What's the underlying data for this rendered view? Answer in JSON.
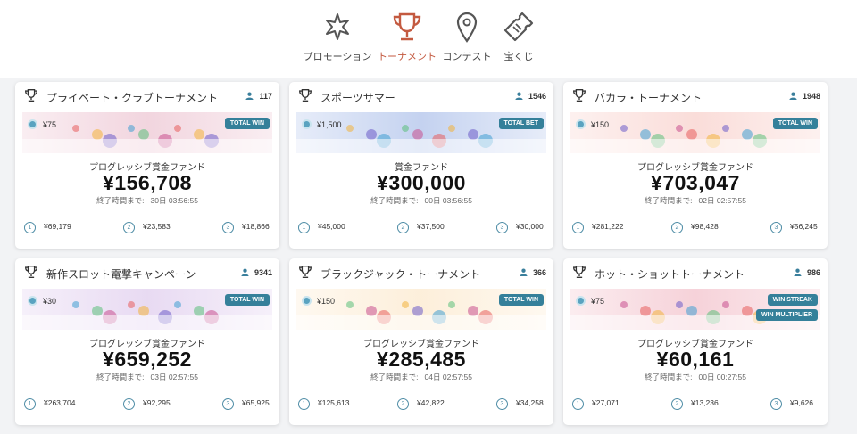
{
  "nav": [
    {
      "label": "プロモーション",
      "icon": "sparkle-icon",
      "active": false
    },
    {
      "label": "トーナメント",
      "icon": "trophy-icon",
      "active": true
    },
    {
      "label": "コンテスト",
      "icon": "location-pin-icon",
      "active": false
    },
    {
      "label": "宝くじ",
      "icon": "ticket-icon",
      "active": false
    }
  ],
  "colors": {
    "accent": "#c45a40",
    "badge": "#35809a",
    "rank": "#4f8da6"
  },
  "cards": [
    {
      "title": "プライベート・クラブトーナメント",
      "players": "117",
      "stake": "¥75",
      "badges": [
        "TOTAL WIN"
      ],
      "fund_label": "プログレッシブ賞金ファンド",
      "amount": "¥156,708",
      "end_label": "終了時間まで:",
      "end_time": "30日 03:56:55",
      "prizes": [
        {
          "rank": "1",
          "value": "¥69,179"
        },
        {
          "rank": "2",
          "value": "¥23,583"
        },
        {
          "rank": "3",
          "value": "¥18,866"
        }
      ],
      "banner_theme": "#e9b9c9"
    },
    {
      "title": "スポーツサマー",
      "players": "1546",
      "stake": "¥1,500",
      "badges": [
        "TOTAL BET"
      ],
      "fund_label": "賞金ファンド",
      "amount": "¥300,000",
      "end_label": "終了時間まで:",
      "end_time": "00日 03:56:55",
      "prizes": [
        {
          "rank": "1",
          "value": "¥45,000"
        },
        {
          "rank": "2",
          "value": "¥37,500"
        },
        {
          "rank": "3",
          "value": "¥30,000"
        }
      ],
      "banner_theme": "#9db4e6"
    },
    {
      "title": "バカラ・トーナメント",
      "players": "1948",
      "stake": "¥150",
      "badges": [
        "TOTAL WIN"
      ],
      "fund_label": "プログレッシブ賞金ファンド",
      "amount": "¥703,047",
      "end_label": "終了時間まで:",
      "end_time": "02日 02:57:55",
      "prizes": [
        {
          "rank": "1",
          "value": "¥281,222"
        },
        {
          "rank": "2",
          "value": "¥98,428"
        },
        {
          "rank": "3",
          "value": "¥56,245"
        }
      ],
      "banner_theme": "#f7c6c0"
    },
    {
      "title": "新作スロット電撃キャンペーン",
      "players": "9341",
      "stake": "¥30",
      "badges": [
        "TOTAL WIN"
      ],
      "fund_label": "プログレッシブ賞金ファンド",
      "amount": "¥659,252",
      "end_label": "終了時間まで:",
      "end_time": "03日 02:57:55",
      "prizes": [
        {
          "rank": "1",
          "value": "¥263,704"
        },
        {
          "rank": "2",
          "value": "¥92,295"
        },
        {
          "rank": "3",
          "value": "¥65,925"
        }
      ],
      "banner_theme": "#d9c2ea"
    },
    {
      "title": "ブラックジャック・トーナメント",
      "players": "366",
      "stake": "¥150",
      "badges": [
        "TOTAL WIN"
      ],
      "fund_label": "プログレッシブ賞金ファンド",
      "amount": "¥285,485",
      "end_label": "終了時間まで:",
      "end_time": "04日 02:57:55",
      "prizes": [
        {
          "rank": "1",
          "value": "¥125,613"
        },
        {
          "rank": "2",
          "value": "¥42,822"
        },
        {
          "rank": "3",
          "value": "¥34,258"
        }
      ],
      "banner_theme": "#fbe4c2"
    },
    {
      "title": "ホット・ショットトーナメント",
      "players": "986",
      "stake": "¥75",
      "badges": [
        "WIN STREAK",
        "WIN MULTIPLIER"
      ],
      "fund_label": "プログレッシブ賞金ファンド",
      "amount": "¥60,161",
      "end_label": "終了時間まで:",
      "end_time": "00日 00:27:55",
      "prizes": [
        {
          "rank": "1",
          "value": "¥27,071"
        },
        {
          "rank": "2",
          "value": "¥13,236"
        },
        {
          "rank": "3",
          "value": "¥9,626"
        }
      ],
      "banner_theme": "#f0b4c0"
    }
  ]
}
